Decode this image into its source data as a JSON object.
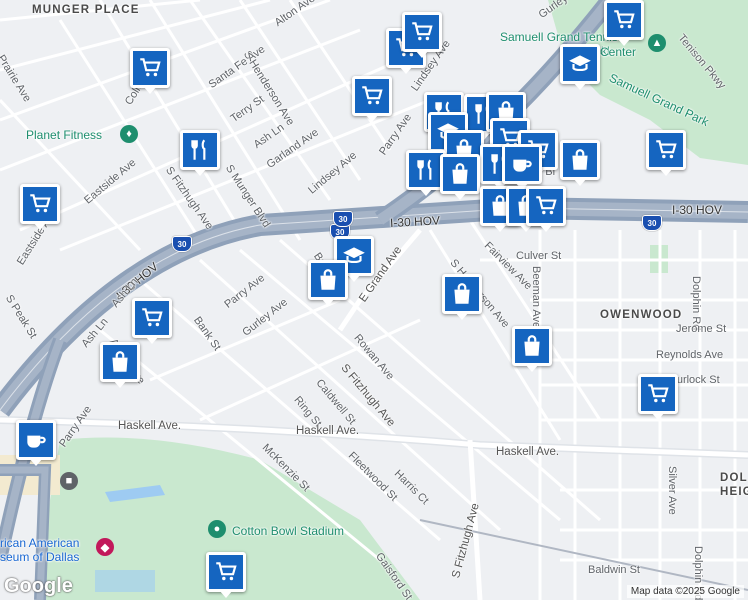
{
  "map": {
    "attribution": "Map data ©2025 Google",
    "logo": "Google",
    "colors": {
      "background": "#eef0f3",
      "park": "#c9e8cf",
      "road": "#ffffff",
      "highway": "#8fa1b9",
      "water": "#9ecbf2",
      "marker": "#1565c0"
    },
    "areas": {
      "munger_place": "MUNGER PLACE",
      "owenwood": "OWENWOOD",
      "dolphin_heights_1": "DOL",
      "dolphin_heights_2": "HEIG"
    },
    "pois": {
      "planet_fitness": "Planet Fitness",
      "cotton_bowl": "Cotton Bowl Stadium",
      "samuell_1": "Samuell Grand Tennis",
      "samuell_2": "& Pickl",
      "samuell_3": "Center",
      "african_museum_1": "rican American",
      "african_museum_2": "seum of Dallas",
      "samuell_park": "Samuell Grand Park"
    },
    "highways": {
      "i30_hov_left": "I-30 HOV",
      "i30_hov_mid": "I-30 HOV",
      "i30_hov_right": "I-30 HOV",
      "shield_30_a": "30",
      "shield_30_b": "30",
      "shield_30_c": "30",
      "shield_30_d": "30"
    },
    "streets": {
      "tenison_pkwy": "Tenison Pkwy",
      "alton_ave": "Alton Ave",
      "s_henderson_top": "S Henderson Ave",
      "santa_fe": "Santa Fe Ave",
      "terry_st": "Terry St",
      "ash_ln_top": "Ash Ln",
      "garland_ave": "Garland Ave",
      "s_munger_blvd": "S Munger Blvd",
      "lindsey_ave_top": "Lindsey Ave",
      "lindsey_ave": "Lindsey Ave",
      "parry_ave_top": "Parry Ave",
      "prairie_ave": "Prairie Ave",
      "collett_ave": "Collett Ave",
      "eastside_ave_top": "Eastside Ave",
      "eastside_ave": "Eastside Ave",
      "s_peak_st": "S Peak St",
      "s_fitzhugh_top": "S Fitzhugh Ave",
      "gurley_top": "Gurley",
      "ash_ln_left": "Ash Ln",
      "ash_ln_left2": "Ash Ln",
      "annex_ave": "Annex Ave",
      "bank_st": "Bank St",
      "parry_ave_mid": "Parry Ave",
      "gurley_ave": "Gurley Ave",
      "barry": "Barry",
      "e_grand_ave": "E Grand Ave",
      "rowan_ave": "Rowan Ave",
      "s_fitzhugh_mid": "S Fitzhugh Ave",
      "caldwell_st": "Caldwell St",
      "ring_st": "Ring St",
      "s_henderson_mid": "S Henderson Ave",
      "fairview_ave": "Fairview Ave",
      "culver_st": "Culver St",
      "beeman_ave": "Beeman Ave",
      "dolphin_rd": "Dolphin Rd",
      "dolphin_rd2": "Dolphin Rd",
      "jerome_st": "Jerome St",
      "reynolds_ave": "Reynolds Ave",
      "scurlock_st": "Scurlock St",
      "haskell_left": "Haskell Ave.",
      "haskell_mid": "Haskell Ave.",
      "haskell_right": "Haskell Ave.",
      "parry_ave_low": "Parry Ave",
      "mckenzie_st": "McKenzie St",
      "fleetwood_st": "Fleetwood St",
      "harris_ct": "Harris Ct",
      "silver_ave": "Silver Ave",
      "s_fitzhugh_low": "S Fitzhugh Ave",
      "gaisford_st": "Gaisford St",
      "baldwin_st": "Baldwin St",
      "grand_blvd_cut": "nd Bl"
    },
    "markers": [
      {
        "type": "shopping-cart",
        "label": "grocery"
      },
      {
        "type": "shopping-cart",
        "label": "grocery"
      },
      {
        "type": "shopping-cart",
        "label": "grocery"
      },
      {
        "type": "shopping-cart",
        "label": "grocery"
      },
      {
        "type": "restaurant",
        "label": "restaurant"
      },
      {
        "type": "school",
        "label": "school"
      },
      {
        "type": "shopping-bag",
        "label": "store"
      },
      {
        "type": "shopping-cart",
        "label": "grocery"
      },
      {
        "type": "shopping-cart",
        "label": "grocery"
      },
      {
        "type": "shopping-bag",
        "label": "store"
      },
      {
        "type": "shopping-bag",
        "label": "store"
      },
      {
        "type": "shopping-bag",
        "label": "store"
      },
      {
        "type": "shopping-cart",
        "label": "grocery"
      },
      {
        "type": "cafe",
        "label": "cafe"
      },
      {
        "type": "shopping-cart",
        "label": "grocery"
      },
      {
        "type": "school",
        "label": "school"
      }
    ]
  }
}
